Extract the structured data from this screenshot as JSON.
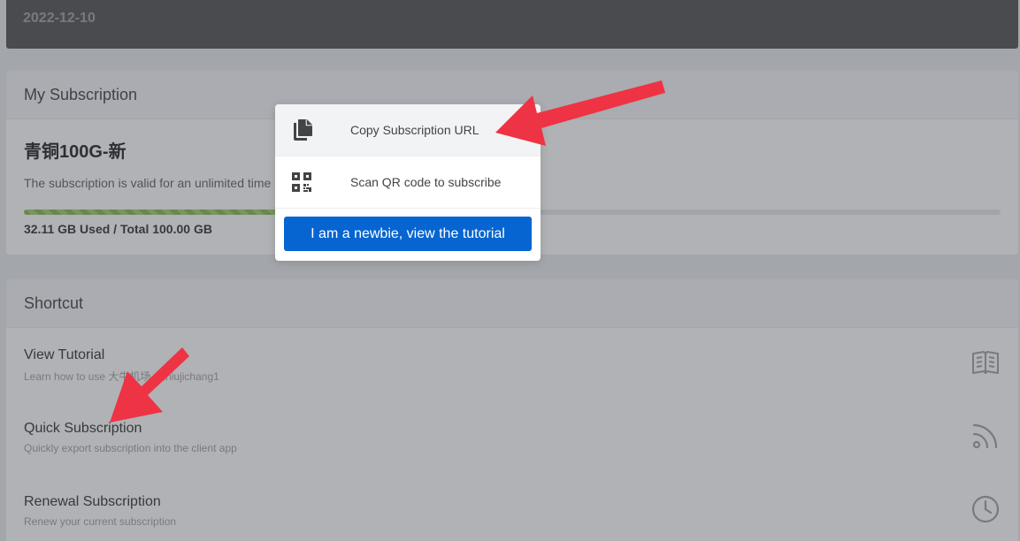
{
  "banner": {
    "date": "2022-12-10"
  },
  "subscription": {
    "header": "My Subscription",
    "plan_name": "青铜100G-新",
    "validity": "The subscription is valid for an unlimited time",
    "usage_text": "32.11 GB Used / Total 100.00 GB",
    "usage_fraction": 0.3211,
    "progress_color": "#8bc34a"
  },
  "shortcut": {
    "header": "Shortcut",
    "items": [
      {
        "title": "View Tutorial",
        "desc": "Learn how to use 大牛机场 daniujichang1",
        "icon": "book-icon"
      },
      {
        "title": "Quick Subscription",
        "desc": "Quickly export subscription into the client app",
        "icon": "rss-icon"
      },
      {
        "title": "Renewal Subscription",
        "desc": "Renew your current subscription",
        "icon": "clock-icon"
      }
    ]
  },
  "popup": {
    "copy_label": "Copy Subscription URL",
    "copy_icon": "copy-icon",
    "qr_label": "Scan QR code to subscribe",
    "qr_icon": "qr-code-icon",
    "tutorial_button": "I am a newbie, view the tutorial",
    "button_color": "#0665d0"
  },
  "annotations": {
    "arrow_color": "#ee3344"
  }
}
